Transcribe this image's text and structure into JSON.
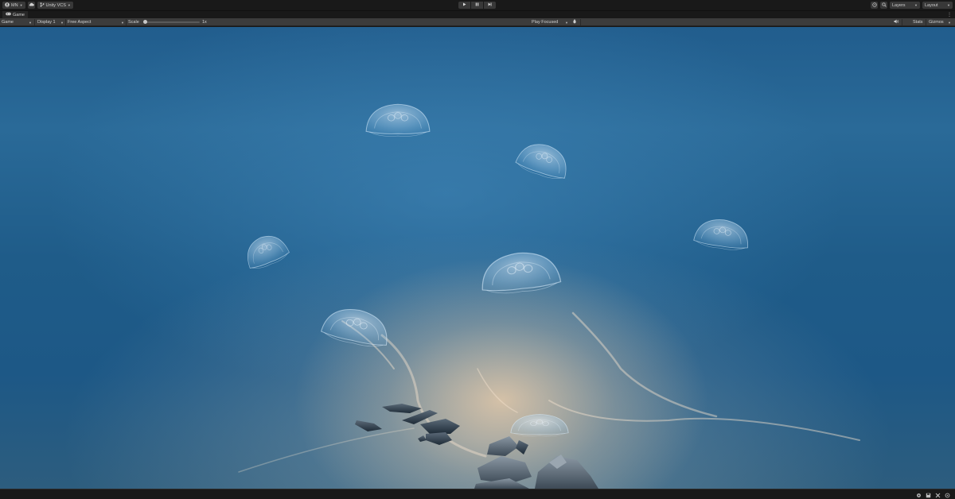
{
  "toolbar": {
    "account_label": "MN",
    "version_control_label": "Unity VCS",
    "layers_label": "Layers",
    "layout_label": "Layout",
    "icons": [
      "account-icon",
      "cloud-icon",
      "branch-icon",
      "play-icon",
      "pause-icon",
      "step-icon",
      "history-icon",
      "search-icon"
    ]
  },
  "tab": {
    "label": "Game",
    "icon": "gamepad-icon"
  },
  "controls": {
    "view_mode": "Game",
    "display": "Display 1",
    "aspect": "Free Aspect",
    "scale_label": "Scale",
    "scale_value": "1x",
    "play_mode": "Play Focused",
    "stats_label": "Stats",
    "gizmos_label": "Gizmos"
  },
  "statusbar": {
    "icons": [
      "settings-icon",
      "save-icon",
      "collab-icon",
      "notifications-icon"
    ]
  },
  "colors": {
    "editor_dark": "#191919",
    "panel": "#3c3c3c",
    "water_deep": "#1d5886",
    "water_light": "#2a6a98",
    "sand_glow": "#ebcdaa"
  }
}
